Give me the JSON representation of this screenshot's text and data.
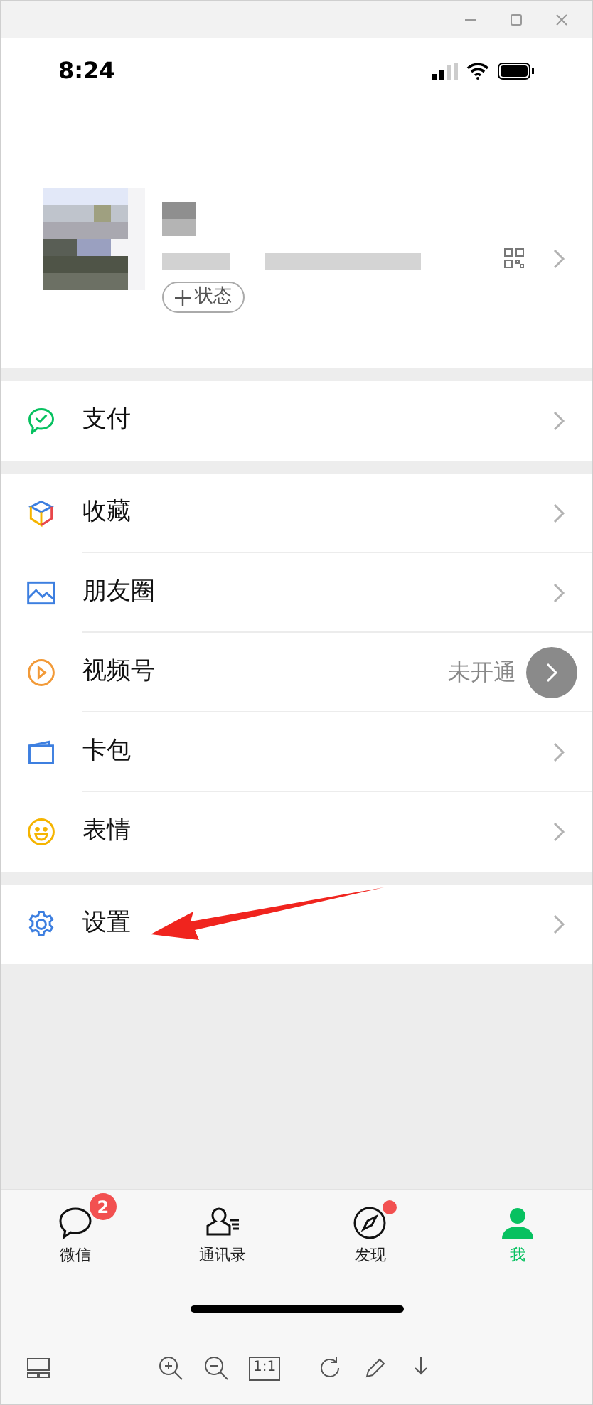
{
  "status_bar": {
    "time": "8:24"
  },
  "profile": {
    "status_button": "状态"
  },
  "menu_groups": [
    [
      {
        "kind": "pay",
        "label": "支付"
      }
    ],
    [
      {
        "kind": "favorites",
        "label": "收藏"
      },
      {
        "kind": "moments",
        "label": "朋友圈"
      },
      {
        "kind": "channels",
        "label": "视频号",
        "value": "未开通"
      },
      {
        "kind": "cards",
        "label": "卡包"
      },
      {
        "kind": "stickers",
        "label": "表情"
      }
    ],
    [
      {
        "kind": "settings",
        "label": "设置"
      }
    ]
  ],
  "tabs": [
    {
      "kind": "chats",
      "label": "微信",
      "badge": "2",
      "selected": false
    },
    {
      "kind": "contacts",
      "label": "通讯录",
      "selected": false
    },
    {
      "kind": "discover",
      "label": "发现",
      "dot": true,
      "selected": false
    },
    {
      "kind": "me",
      "label": "我",
      "selected": true
    }
  ],
  "viewer_toolbar": {
    "actual_size": "1:1"
  }
}
